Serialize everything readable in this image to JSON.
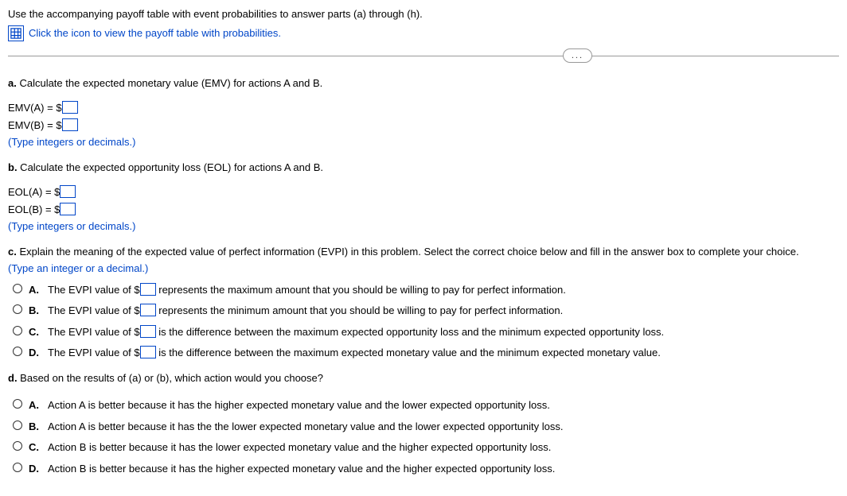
{
  "intro": "Use the accompanying payoff table with event probabilities to answer parts (a) through (h).",
  "icon_link": "Click the icon to view the payoff table with probabilities.",
  "a": {
    "prompt_label": "a.",
    "prompt": " Calculate the expected monetary value (EMV) for actions A and B.",
    "emv_a": "EMV(A) = $",
    "emv_b": "EMV(B) = $",
    "hint": "(Type integers or decimals.)"
  },
  "b": {
    "prompt_label": "b.",
    "prompt": " Calculate the expected opportunity loss (EOL) for actions A and B.",
    "eol_a": "EOL(A) = $",
    "eol_b": "EOL(B) = $",
    "hint": "(Type integers or decimals.)"
  },
  "c": {
    "prompt_label": "c.",
    "prompt": " Explain the meaning of the expected value of perfect information (EVPI) in this problem. Select the correct choice below and fill in the answer box to complete your choice.",
    "hint": "(Type an integer or a decimal.)",
    "choices": {
      "A": {
        "pre": "The EVPI value of $",
        "post": " represents the maximum amount that you should be willing to pay for perfect information."
      },
      "B": {
        "pre": "The EVPI value of $",
        "post": " represents the minimum amount that you should be willing to pay for perfect information."
      },
      "C": {
        "pre": "The EVPI value of $",
        "post": " is the difference between the maximum expected opportunity loss and the minimum expected opportunity loss."
      },
      "D": {
        "pre": "The EVPI value of $",
        "post": " is the difference between the maximum expected monetary value and the minimum expected monetary value."
      }
    },
    "labels": {
      "A": "A.",
      "B": "B.",
      "C": "C.",
      "D": "D."
    }
  },
  "d": {
    "prompt_label": "d.",
    "prompt": " Based on the results of (a) or (b), which action would you choose?",
    "choices": {
      "A": "Action A is better because it has the higher expected monetary value and the lower expected opportunity loss.",
      "B": "Action A is better because it has the the lower expected monetary value and the lower expected opportunity loss.",
      "C": "Action B is better because it has the lower expected monetary value and the higher expected opportunity loss.",
      "D": "Action B is better because it has the higher expected monetary value and the higher expected opportunity loss."
    },
    "labels": {
      "A": "A.",
      "B": "B.",
      "C": "C.",
      "D": "D."
    }
  },
  "ellipsis": "..."
}
